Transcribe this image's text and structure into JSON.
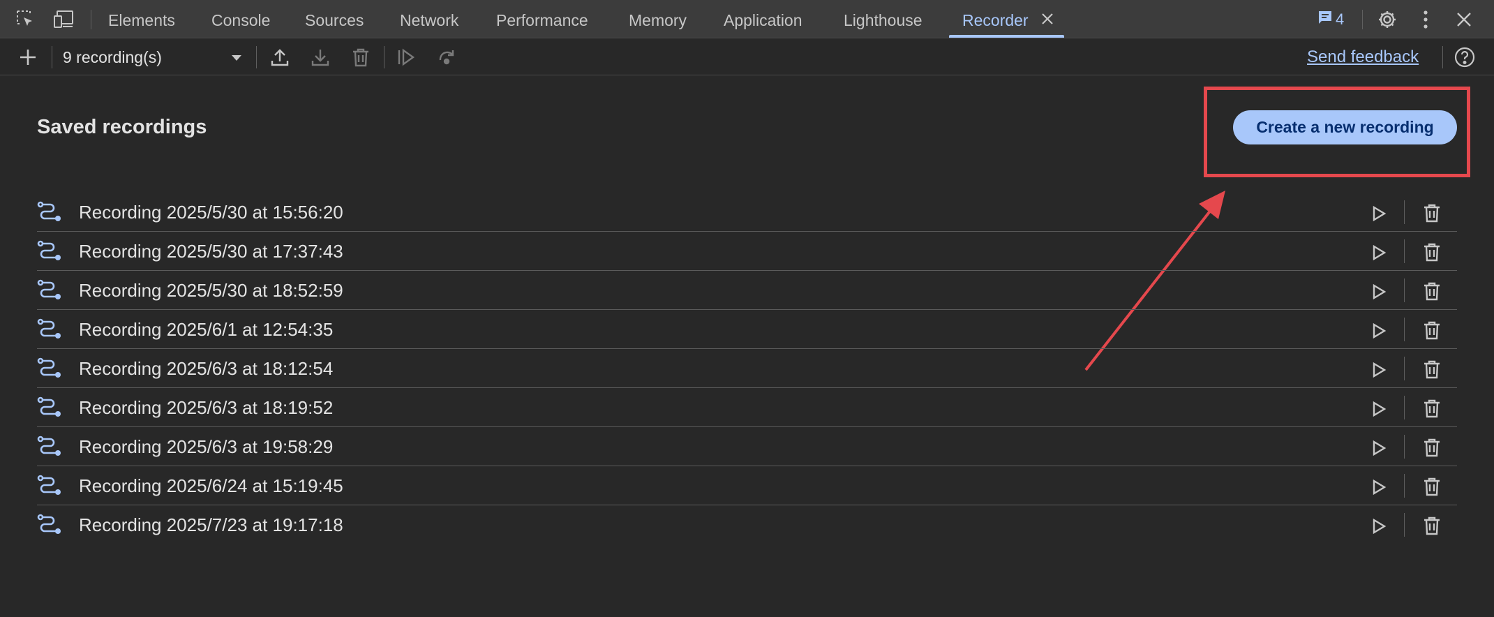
{
  "tabbar": {
    "tabs": [
      {
        "label": "Elements"
      },
      {
        "label": "Console"
      },
      {
        "label": "Sources"
      },
      {
        "label": "Network"
      },
      {
        "label": "Performance"
      },
      {
        "label": "Memory"
      },
      {
        "label": "Application"
      },
      {
        "label": "Lighthouse"
      },
      {
        "label": "Recorder"
      }
    ],
    "active_tab": "Recorder",
    "issues_count": "4",
    "icons": {
      "inspect": "inspect-element-icon",
      "device": "device-toolbar-icon",
      "close_tab": "close-icon",
      "issues": "message-icon",
      "settings": "gear-icon",
      "more": "more-vertical-icon",
      "close_devtools": "close-icon"
    }
  },
  "toolbar": {
    "recordings_select": "9 recording(s)",
    "send_feedback": "Send feedback",
    "icons": [
      "plus-icon",
      "upload-icon",
      "download-icon",
      "trash-icon",
      "replay-icon",
      "rerun-icon",
      "help-icon"
    ]
  },
  "main": {
    "title": "Saved recordings",
    "create_button": "Create a new recording",
    "recordings": [
      {
        "label": "Recording 2025/5/30 at 15:56:20"
      },
      {
        "label": "Recording 2025/5/30 at 17:37:43"
      },
      {
        "label": "Recording 2025/5/30 at 18:52:59"
      },
      {
        "label": "Recording 2025/6/1 at 12:54:35"
      },
      {
        "label": "Recording 2025/6/3 at 18:12:54"
      },
      {
        "label": "Recording 2025/6/3 at 18:19:52"
      },
      {
        "label": "Recording 2025/6/3 at 19:58:29"
      },
      {
        "label": "Recording 2025/6/24 at 15:19:45"
      },
      {
        "label": "Recording 2025/7/23 at 19:17:18"
      }
    ]
  },
  "colors": {
    "background": "#282828",
    "tabbar": "#3c3c3c",
    "accent": "#a8c7fa",
    "annotation": "#e5484d"
  }
}
